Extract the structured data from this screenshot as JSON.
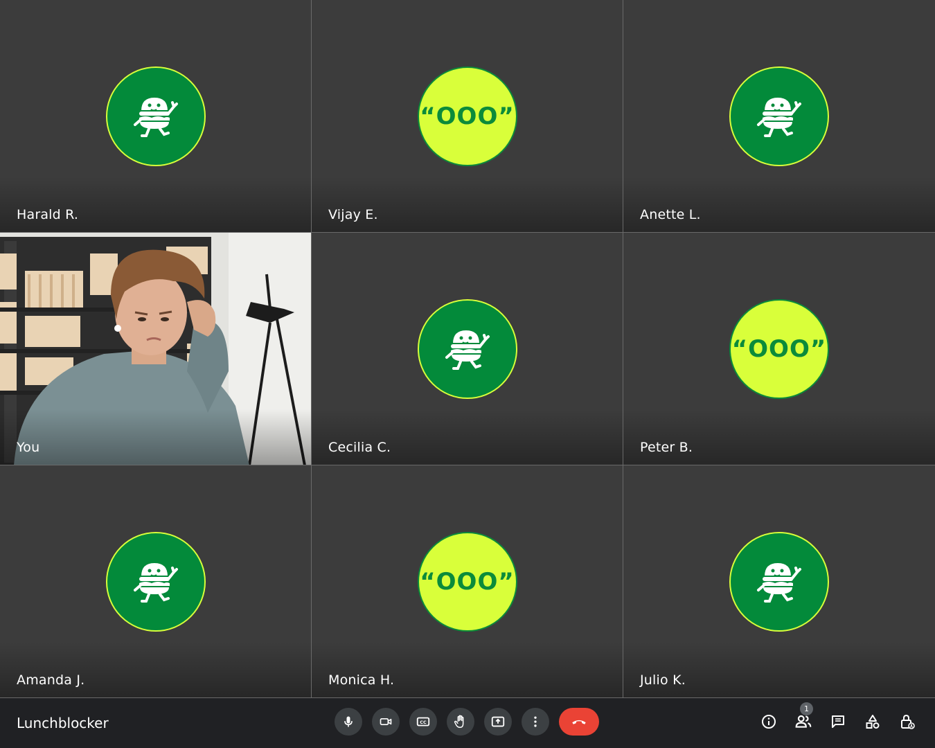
{
  "participants": [
    {
      "name": "Harald R.",
      "avatar": "burger-mascot"
    },
    {
      "name": "Vijay E.",
      "avatar": "quote-ooo"
    },
    {
      "name": "Anette L.",
      "avatar": "burger-mascot"
    },
    {
      "name": "You",
      "avatar": "camera-video"
    },
    {
      "name": "Cecilia C.",
      "avatar": "burger-mascot"
    },
    {
      "name": "Peter B.",
      "avatar": "quote-ooo"
    },
    {
      "name": "Amanda J.",
      "avatar": "burger-mascot"
    },
    {
      "name": "Monica H.",
      "avatar": "quote-ooo"
    },
    {
      "name": "Julio K.",
      "avatar": "burger-mascot"
    }
  ],
  "avatar_ooo_text": "“OOO”",
  "meeting": {
    "title": "Lunchblocker"
  },
  "people_count": "1",
  "colors": {
    "tile_bg": "#3c3c3c",
    "avatar_green": "#038a3a",
    "avatar_lime": "#d9ff3a",
    "end_call": "#ea4335",
    "bar_bg": "#202124"
  },
  "controls": [
    "microphone-icon",
    "camera-icon",
    "captions-icon",
    "raise-hand-icon",
    "present-screen-icon",
    "more-options-icon",
    "end-call-icon"
  ],
  "right_controls": [
    "info-icon",
    "people-icon",
    "chat-icon",
    "activities-icon",
    "host-controls-icon"
  ]
}
